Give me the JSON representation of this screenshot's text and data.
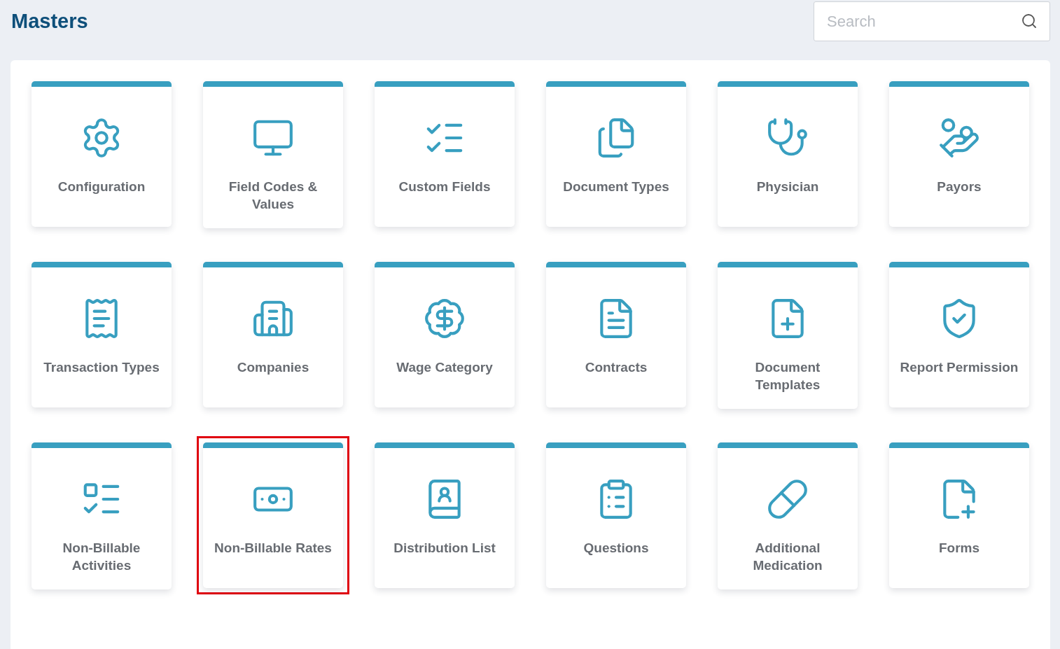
{
  "title": "Masters",
  "search": {
    "placeholder": "Search"
  },
  "tiles": [
    {
      "label": "Configuration",
      "highlighted": false
    },
    {
      "label": "Field Codes & Values",
      "highlighted": false
    },
    {
      "label": "Custom Fields",
      "highlighted": false
    },
    {
      "label": "Document Types",
      "highlighted": false
    },
    {
      "label": "Physician",
      "highlighted": false
    },
    {
      "label": "Payors",
      "highlighted": false
    },
    {
      "label": "Transaction Types",
      "highlighted": false
    },
    {
      "label": "Companies",
      "highlighted": false
    },
    {
      "label": "Wage Category",
      "highlighted": false
    },
    {
      "label": "Contracts",
      "highlighted": false
    },
    {
      "label": "Document Templates",
      "highlighted": false
    },
    {
      "label": "Report Permission",
      "highlighted": false
    },
    {
      "label": "Non-Billable Activities",
      "highlighted": false
    },
    {
      "label": "Non-Billable Rates",
      "highlighted": true
    },
    {
      "label": "Distribution List",
      "highlighted": false
    },
    {
      "label": "Questions",
      "highlighted": false
    },
    {
      "label": "Additional Medication",
      "highlighted": false
    },
    {
      "label": "Forms",
      "highlighted": false
    }
  ]
}
